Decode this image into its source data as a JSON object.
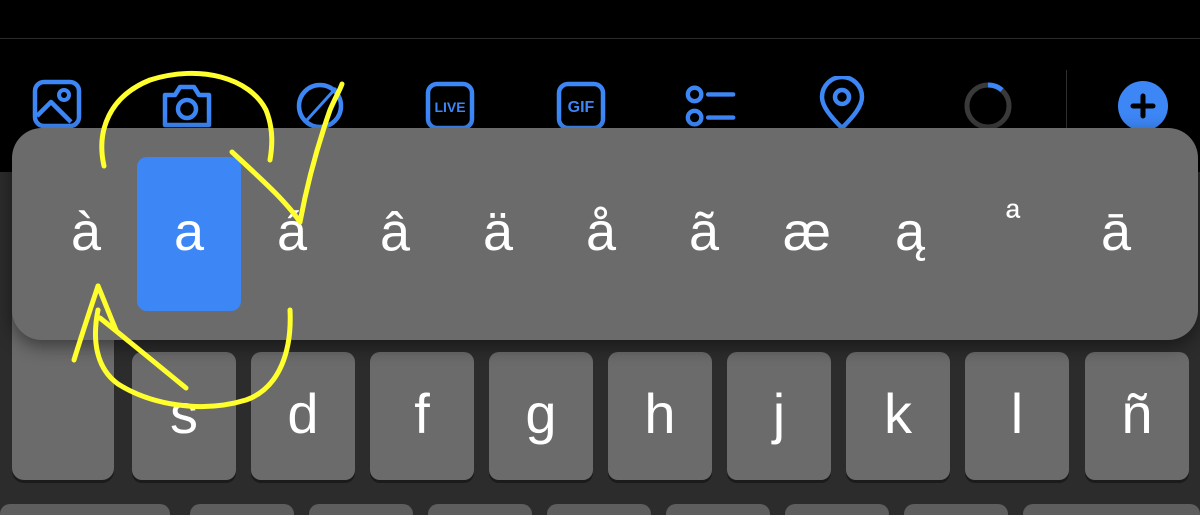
{
  "toolbar": {
    "items": [
      {
        "name": "photo-library",
        "icon": "image-icon"
      },
      {
        "name": "camera",
        "icon": "camera-icon"
      },
      {
        "name": "drawing",
        "icon": "pen-icon"
      },
      {
        "name": "live",
        "icon": "live-icon",
        "label": "LIVE"
      },
      {
        "name": "gif",
        "icon": "gif-icon",
        "label": "GIF"
      },
      {
        "name": "poll",
        "icon": "list-icon"
      },
      {
        "name": "location",
        "icon": "location-pin-icon"
      },
      {
        "name": "character-counter",
        "icon": "progress-ring-icon"
      },
      {
        "name": "add",
        "icon": "plus-icon"
      }
    ]
  },
  "accent_popup": {
    "characters": [
      "à",
      "a",
      "á",
      "â",
      "ä",
      "å",
      "ã",
      "æ",
      "ą",
      "ª",
      "ā"
    ],
    "selected_index": 1
  },
  "keyboard": {
    "home_row": [
      "s",
      "d",
      "f",
      "g",
      "h",
      "j",
      "k",
      "l",
      "ñ"
    ]
  },
  "colors": {
    "accent": "#3d86f5",
    "annotation": "#ffff2e",
    "key": "#6b6b6b",
    "keyboard_bg": "#2c2c2c"
  }
}
